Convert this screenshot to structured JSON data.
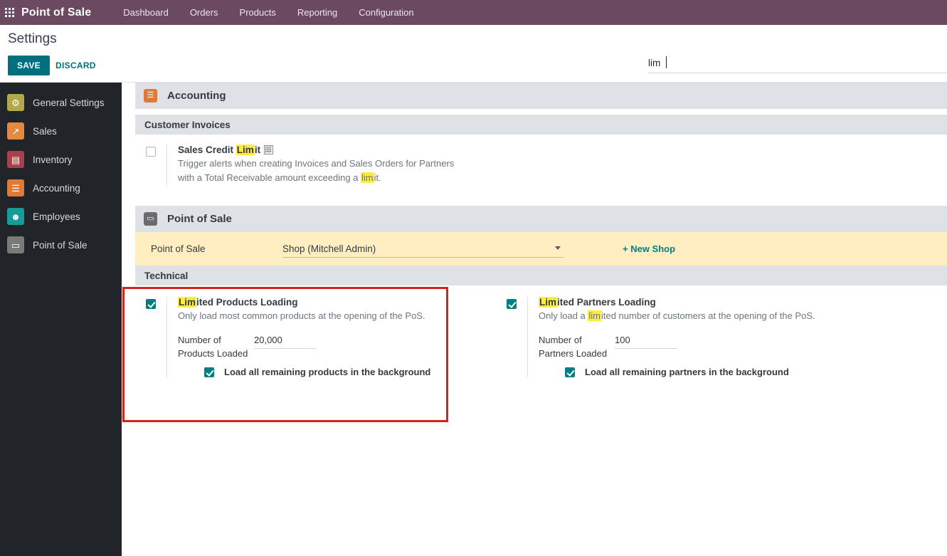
{
  "navbar": {
    "apps_icon": "apps-grid-icon",
    "brand": "Point of Sale",
    "menu": [
      {
        "label": "Dashboard"
      },
      {
        "label": "Orders"
      },
      {
        "label": "Products"
      },
      {
        "label": "Reporting"
      },
      {
        "label": "Configuration"
      }
    ],
    "bg_color": "#6b4961"
  },
  "control_panel": {
    "title": "Settings",
    "save_label": "SAVE",
    "discard_label": "DISCARD",
    "save_color": "#00707f",
    "search": {
      "value": "lim",
      "placeholder": ""
    }
  },
  "sidebar": {
    "items": [
      {
        "label": "General Settings",
        "icon": "gear-icon",
        "glyph": "⚙",
        "color": "#b3a84a"
      },
      {
        "label": "Sales",
        "icon": "chart-line-icon",
        "glyph": "↗",
        "color": "#e08a42"
      },
      {
        "label": "Inventory",
        "icon": "boxes-icon",
        "glyph": "▤",
        "color": "#a8414a"
      },
      {
        "label": "Accounting",
        "icon": "invoice-icon",
        "glyph": "☰",
        "color": "#dd7b3b"
      },
      {
        "label": "Employees",
        "icon": "people-icon",
        "glyph": "☻",
        "color": "#179b9b"
      },
      {
        "label": "Point of Sale",
        "icon": "pos-terminal-icon",
        "glyph": "▭",
        "color": "#7a7a7a"
      }
    ]
  },
  "sections": {
    "accounting": {
      "name": "Accounting",
      "icon": "accounting-app-icon",
      "glyph": "☰",
      "icon_color": "#dd7b3b",
      "group": "Customer Invoices",
      "setting": {
        "checked": false,
        "title_pre": "Sales Credit ",
        "title_highlight": "Lim",
        "title_post": "it",
        "badge_icon": "company-building-icon",
        "desc_line1": "Trigger alerts when creating Invoices and Sales Orders for Partners",
        "desc_line2_pre": "with a Total Receivable amount exceeding a ",
        "desc_line2_highlight": "lim",
        "desc_line2_post": "it."
      }
    },
    "point_of_sale": {
      "name": "Point of Sale",
      "icon": "pos-app-icon",
      "glyph": "▭",
      "icon_color": "#6b6b6b",
      "selector": {
        "label": "Point of Sale",
        "selected": "Shop (Mitchell Admin)",
        "options": [
          "Shop (Mitchell Admin)"
        ],
        "new_shop_label": "+ New Shop",
        "strip_color": "#ffeec2"
      },
      "group": "Technical",
      "highlight_color": "#d9211c",
      "products": {
        "checked": true,
        "title_highlight": "Lim",
        "title_post": "ited Products Loading",
        "desc": "Only load most common products at the opening of the PoS.",
        "number_label": "Number of Products Loaded",
        "number_value": "20,000",
        "background_checked": true,
        "background_label": "Load all remaining products in the background"
      },
      "partners": {
        "checked": true,
        "title_highlight": "Lim",
        "title_post": "ited Partners Loading",
        "desc_pre": "Only load a ",
        "desc_highlight": "lim",
        "desc_post": "ited number of customers at the opening of the PoS.",
        "number_label": "Number of Partners Loaded",
        "number_value": "100",
        "background_checked": true,
        "background_label": "Load all remaining partners in the background"
      }
    }
  }
}
